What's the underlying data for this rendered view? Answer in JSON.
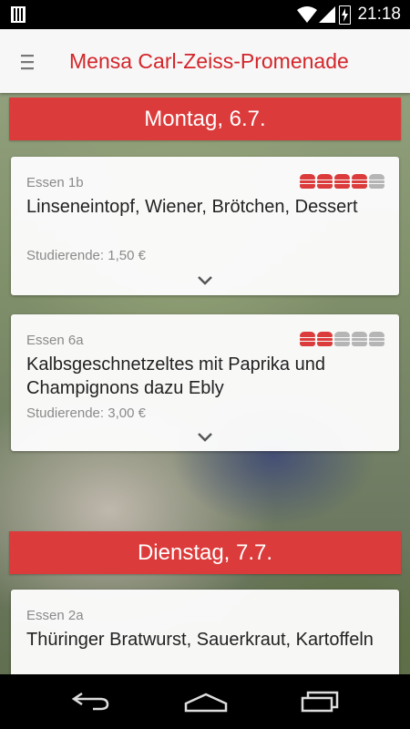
{
  "statusbar": {
    "time": "21:18"
  },
  "appbar": {
    "title": "Mensa Carl-Zeiss-Promenade"
  },
  "colors": {
    "accent": "#d3252a",
    "header": "#dc3b3b",
    "rating_on": "#dc3b3b",
    "rating_off": "#b5b5b5"
  },
  "days": [
    {
      "header": "Montag, 6.7."
    },
    {
      "header": "Dienstag, 7.7."
    }
  ],
  "meals": [
    {
      "label": "Essen 1b",
      "dish": "Linseneintopf, Wiener, Brötchen, Dessert",
      "price": "Studierende: 1,50 €",
      "rating": 4,
      "rating_max": 5
    },
    {
      "label": "Essen 6a",
      "dish": "Kalbsgeschnetzeltes mit Paprika und Champignons dazu Ebly",
      "price": "Studierende: 3,00 €",
      "rating": 2,
      "rating_max": 5
    },
    {
      "label": "Essen 2a",
      "dish": "Thüringer Bratwurst, Sauerkraut, Kartoffeln"
    }
  ],
  "icons": {
    "menu": "hamburger-menu-icon",
    "expand": "chevron-down-icon",
    "rating": "burger-icon",
    "nav_back": "back-icon",
    "nav_home": "home-icon",
    "nav_recents": "recents-icon"
  }
}
